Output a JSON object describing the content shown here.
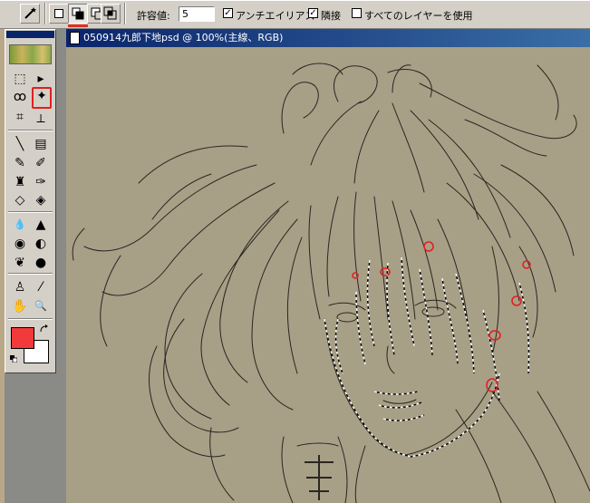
{
  "options_bar": {
    "tool_icon": "magic-wand-icon",
    "selection_modes": [
      "new-selection-icon",
      "add-to-selection-icon",
      "subtract-from-selection-icon",
      "intersect-selection-icon"
    ],
    "tolerance_label": "許容値:",
    "tolerance_value": "5",
    "antialias": {
      "label": "アンチエイリアス",
      "checked": true,
      "mark": "✓"
    },
    "contiguous": {
      "label": "隣接",
      "checked": true,
      "mark": "✓"
    },
    "all_layers": {
      "label": "すべてのレイヤーを使用",
      "checked": false,
      "mark": ""
    }
  },
  "tools": [
    {
      "name": "marquee-icon",
      "glyph": "⬚"
    },
    {
      "name": "move-icon",
      "glyph": "▸"
    },
    {
      "name": "lasso-icon",
      "glyph": "ꝏ"
    },
    {
      "name": "magic-wand-icon",
      "glyph": "✦"
    },
    {
      "name": "crop-icon",
      "glyph": "⌗"
    },
    {
      "name": "slice-icon",
      "glyph": "⟂"
    },
    {
      "name": "line-icon",
      "glyph": "╲"
    },
    {
      "name": "gradient-icon",
      "glyph": "▤"
    },
    {
      "name": "healing-brush-icon",
      "glyph": "✎"
    },
    {
      "name": "brush-icon",
      "glyph": "✐"
    },
    {
      "name": "stamp-icon",
      "glyph": "♜"
    },
    {
      "name": "history-brush-icon",
      "glyph": "✑"
    },
    {
      "name": "eraser-icon",
      "glyph": "◇"
    },
    {
      "name": "fill-icon",
      "glyph": "◈"
    },
    {
      "name": "blur-icon",
      "glyph": "💧"
    },
    {
      "name": "sharpen-icon",
      "glyph": "▲"
    },
    {
      "name": "dodge-icon",
      "glyph": "◉"
    },
    {
      "name": "burn-icon",
      "glyph": "◐"
    },
    {
      "name": "sponge-icon",
      "glyph": "❦"
    },
    {
      "name": "smudge-icon",
      "glyph": "●"
    },
    {
      "name": "type-icon",
      "glyph": "♙"
    },
    {
      "name": "eyedropper-icon",
      "glyph": "⁄"
    },
    {
      "name": "hand-icon",
      "glyph": "✋"
    },
    {
      "name": "zoom-icon",
      "glyph": "🔍"
    }
  ],
  "colors": {
    "foreground": "#f23a3a",
    "background": "#ffffff",
    "canvas": "#a89f87",
    "line_art": "#2a2620",
    "marks": "#e02020"
  },
  "document": {
    "title": "050914九郎下地psd @ 100%(主線、RGB)"
  }
}
